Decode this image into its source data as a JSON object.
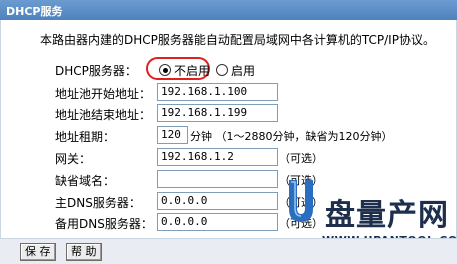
{
  "window": {
    "title": "DHCP服务"
  },
  "description": "本路由器内建的DHCP服务器能自动配置局域网中各计算机的TCP/IP协议。",
  "dhcp_server": {
    "label": "DHCP服务器：",
    "options": [
      {
        "label": "不启用",
        "selected": true
      },
      {
        "label": "启用",
        "selected": false
      }
    ],
    "highlight_color": "#e02020"
  },
  "fields": {
    "start_address": {
      "label": "地址池开始地址：",
      "value": "192.168.1.100"
    },
    "end_address": {
      "label": "地址池结束地址：",
      "value": "192.168.1.199"
    },
    "lease_time": {
      "label": "地址租期：",
      "value": "120",
      "suffix": "分钟 （1～2880分钟，缺省为120分钟）"
    },
    "gateway": {
      "label": "网关：",
      "value": "192.168.1.2",
      "suffix": "（可选）"
    },
    "domain": {
      "label": "缺省域名：",
      "value": "",
      "suffix": "（可选）"
    },
    "primary_dns": {
      "label": "主DNS服务器：",
      "value": "0.0.0.0",
      "suffix": "（可选）"
    },
    "secondary_dns": {
      "label": "备用DNS服务器：",
      "value": "0.0.0.0",
      "suffix": "（可选）"
    }
  },
  "buttons": {
    "save": "保 存",
    "help": "帮 助"
  },
  "watermark": {
    "logo_letter": "U",
    "brand": "盘量产网",
    "url": "WWW.UPANTOOL.COM"
  },
  "colors": {
    "title_bar": "#5b8cc7",
    "border": "#c9d6e3",
    "watermark": "#1d2f4d"
  }
}
